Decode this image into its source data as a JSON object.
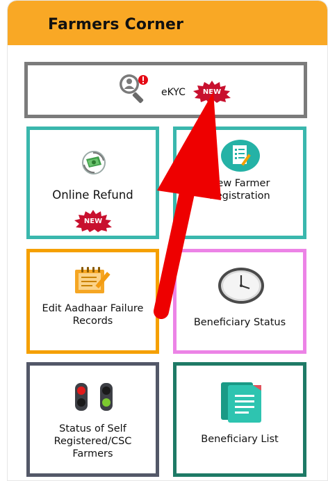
{
  "panel": {
    "title": "Farmers Corner"
  },
  "badge": {
    "text": "NEW"
  },
  "cards": {
    "ekyc": {
      "label": "eKYC",
      "icon": "search-user-alert-icon"
    },
    "online_refund": {
      "label": "Online Refund",
      "icon": "refund-coin-icon"
    },
    "new_farmer": {
      "label_line1": "New Farmer",
      "label_line2": "Registration",
      "icon": "registration-form-icon"
    },
    "edit_aadhaar": {
      "label_line1": "Edit Aadhaar Failure",
      "label_line2": "Records",
      "icon": "edit-document-icon"
    },
    "beneficiary_status": {
      "label": "Beneficiary Status",
      "icon": "clock-icon"
    },
    "self_registered": {
      "label_line1": "Status of Self",
      "label_line2": "Registered/CSC",
      "label_line3": "Farmers",
      "icon": "traffic-light-icon"
    },
    "beneficiary_list": {
      "label": "Beneficiary List",
      "icon": "document-list-icon"
    }
  },
  "colors": {
    "header": "#f9a825",
    "ekyc_border": "#7b7b7b",
    "teal_border": "#3ab7ad",
    "orange_border": "#f5a000",
    "pink_border": "#ec83e6",
    "slate_border": "#535868",
    "green_border": "#1e7a66",
    "annotation_arrow": "#e60000"
  }
}
